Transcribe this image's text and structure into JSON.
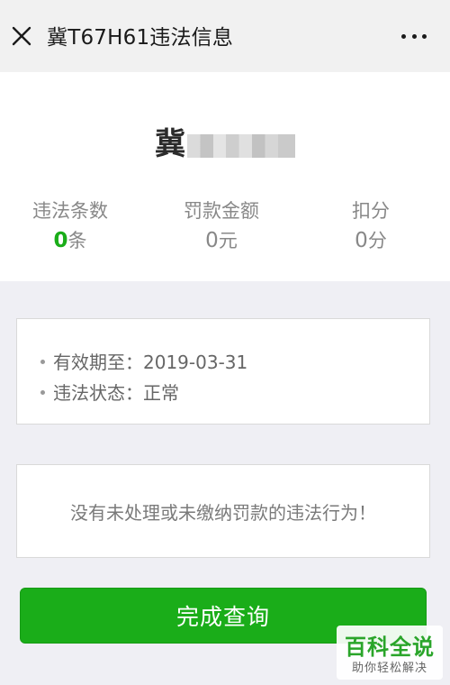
{
  "header": {
    "title": "冀T67H61违法信息",
    "close_icon": "close-icon",
    "more_icon": "more-horizontal-icon"
  },
  "summary": {
    "plate_prefix": "冀",
    "plate_masked_text": "T67H61",
    "stats": [
      {
        "label": "违法条数",
        "value": "0",
        "unit": "条"
      },
      {
        "label": "罚款金额",
        "value": "0",
        "unit": "元"
      },
      {
        "label": "扣分",
        "value": "0",
        "unit": "分"
      }
    ]
  },
  "info": {
    "valid_until": "有效期至：2019-03-31",
    "status": "违法状态：正常"
  },
  "message": "没有未处理或未缴纳罚款的违法行为！",
  "button": {
    "label": "完成查询"
  },
  "watermark": {
    "main": "百科全说",
    "sub": "助你轻松解决"
  },
  "colors": {
    "accent_green": "#1aad19",
    "header_bg": "#f1f1f1",
    "page_bg": "#efeff4"
  }
}
